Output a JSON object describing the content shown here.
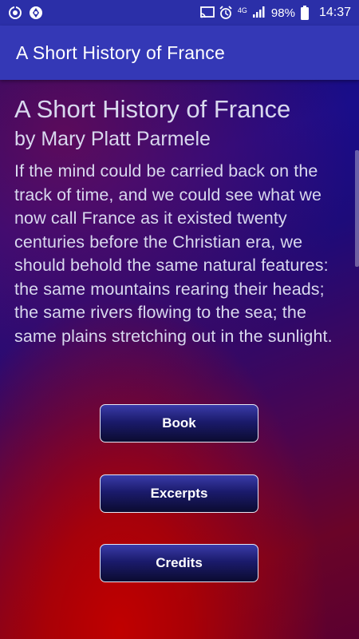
{
  "status_bar": {
    "network": "4G",
    "battery": "98%",
    "time": "14:37",
    "icons": [
      "sync-icon",
      "shutter-icon",
      "cast-icon",
      "alarm-icon",
      "signal-icon",
      "battery-icon"
    ]
  },
  "app_bar": {
    "title": "A Short History of France"
  },
  "main": {
    "title": "A Short History of France",
    "author": "by Mary Platt Parmele",
    "intro": "If the mind could be carried back on the track of time, and we could see what we now call France as it existed twenty centuries before the Christian era, we should behold the same natural features: the same mountains rearing their heads; the same rivers flowing to the sea; the same plains stretching out in the sunlight."
  },
  "buttons": {
    "book": "Book",
    "excerpts": "Excerpts",
    "credits": "Credits"
  },
  "colors": {
    "status_bar": "#2b2fa8",
    "app_bar": "#3438b6",
    "text": "#d8d8ee"
  }
}
